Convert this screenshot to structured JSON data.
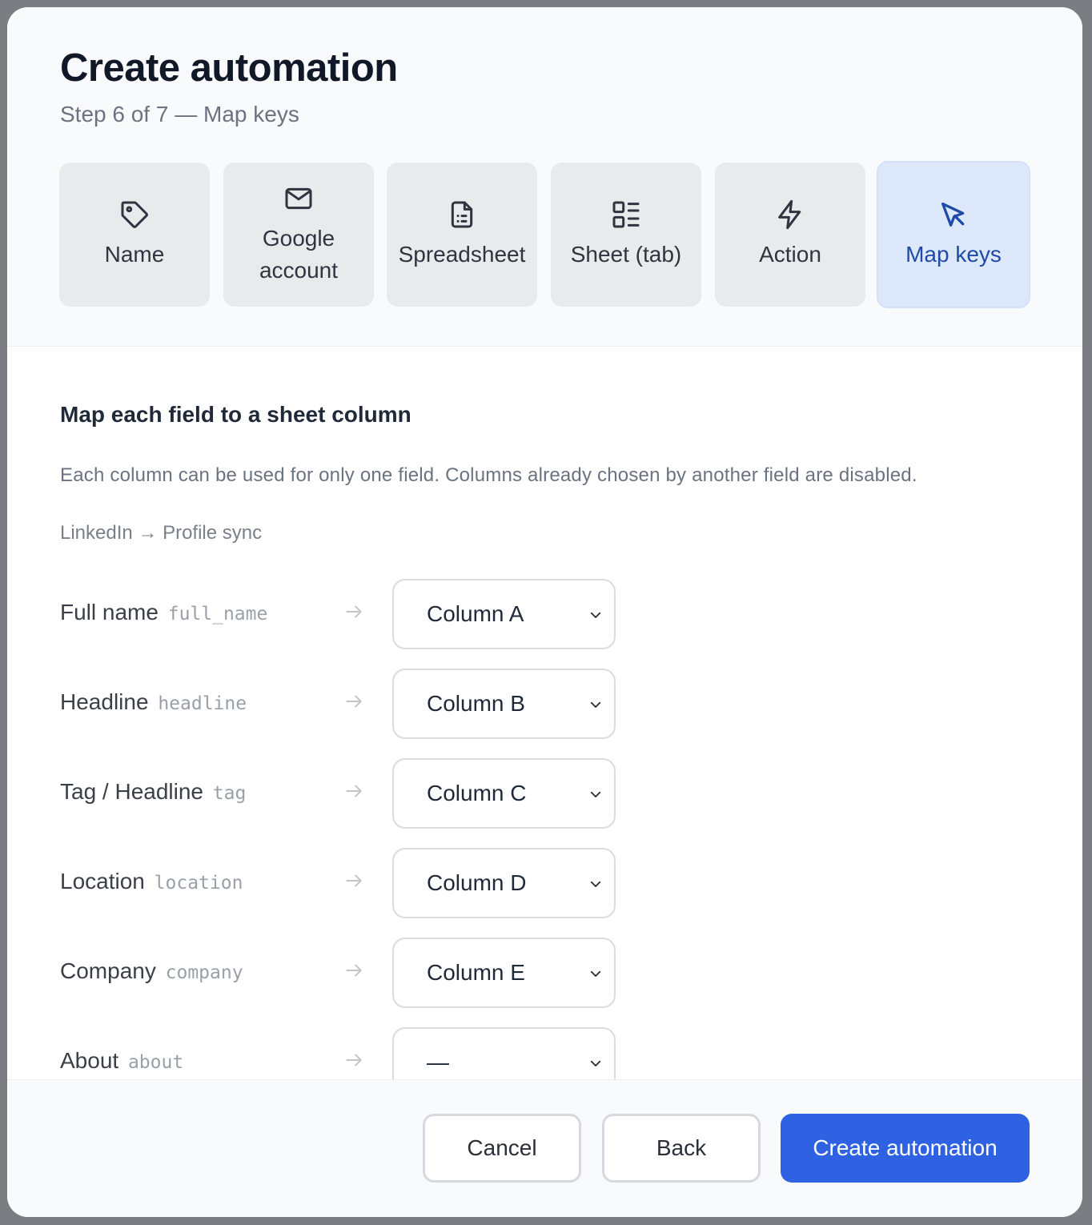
{
  "header": {
    "title": "Create automation",
    "subtitle": "Step 6 of 7 — Map keys"
  },
  "steps": [
    {
      "label": "Name",
      "icon": "tag-icon"
    },
    {
      "label": "Google account",
      "icon": "mail-icon"
    },
    {
      "label": "Spreadsheet",
      "icon": "spreadsheet-file-icon"
    },
    {
      "label": "Sheet (tab)",
      "icon": "sheet-grid-icon"
    },
    {
      "label": "Action",
      "icon": "lightning-icon"
    },
    {
      "label": "Map keys",
      "icon": "cursor-arrow-icon",
      "active": true
    }
  ],
  "section": {
    "title": "Map each field to a sheet column",
    "help": "Each column can be used for only one field. Columns already chosen by another field are disabled.",
    "crumb": "LinkedIn → Profile sync"
  },
  "mappings": [
    {
      "label": "Full name",
      "key": "full_name",
      "column": "Column A"
    },
    {
      "label": "Headline",
      "key": "headline",
      "column": "Column B"
    },
    {
      "label": "Tag / Headline",
      "key": "tag",
      "column": "Column C"
    },
    {
      "label": "Location",
      "key": "location",
      "column": "Column D"
    },
    {
      "label": "Company",
      "key": "company",
      "column": "Column E"
    },
    {
      "label": "About",
      "key": "about",
      "column": "—"
    }
  ],
  "footer": {
    "cancel": "Cancel",
    "back": "Back",
    "create": "Create automation"
  },
  "colors": {
    "primary": "#2f62e3",
    "active_step_bg": "#dde8fb",
    "active_step_text": "#1f4aa8"
  }
}
